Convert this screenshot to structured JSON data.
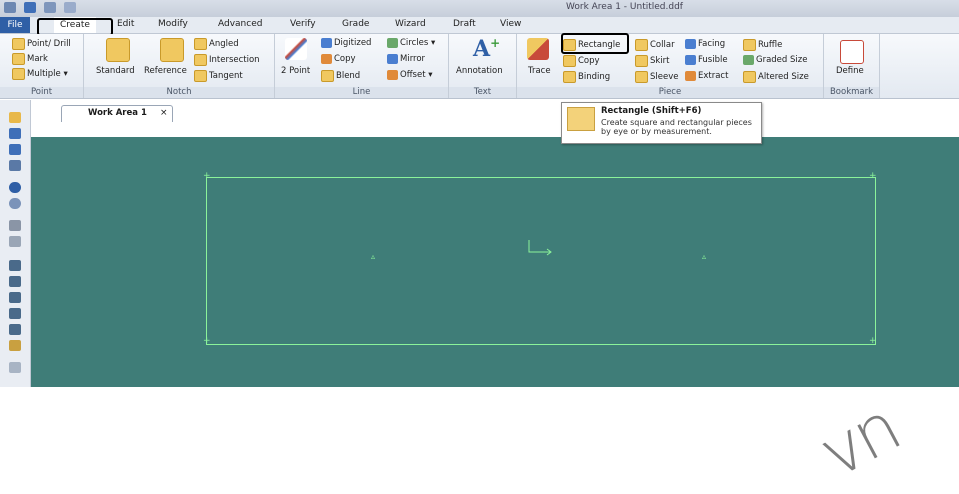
{
  "window": {
    "title": "Work Area 1 - Untitled.ddf"
  },
  "menu": {
    "file": "File",
    "create": "Create",
    "edit": "Edit",
    "modify": "Modify",
    "advanced": "Advanced",
    "verify": "Verify",
    "grade": "Grade",
    "wizard": "Wizard",
    "draft": "Draft",
    "view": "View"
  },
  "ribbon": {
    "point": {
      "label": "Point",
      "point_drill": "Point/ Drill",
      "mark": "Mark",
      "multiple": "Multiple ▾"
    },
    "notch": {
      "label": "Notch",
      "standard": "Standard",
      "reference": "Reference",
      "angled": "Angled",
      "intersection": "Intersection",
      "tangent": "Tangent"
    },
    "line": {
      "label": "Line",
      "two_point": "2 Point",
      "digitized": "Digitized",
      "copy": "Copy",
      "blend": "Blend",
      "circles": "Circles ▾",
      "mirror": "Mirror",
      "offset": "Offset ▾"
    },
    "text": {
      "label": "Text",
      "annotation": "Annotation"
    },
    "piece": {
      "label": "Piece",
      "trace": "Trace",
      "rectangle": "Rectangle",
      "copy": "Copy",
      "binding": "Binding",
      "collar": "Collar",
      "skirt": "Skirt",
      "sleeve": "Sleeve",
      "facing": "Facing",
      "fusible": "Fusible",
      "extract": "Extract",
      "ruffle": "Ruffle",
      "graded_size": "Graded Size",
      "altered_size": "Altered Size"
    },
    "bookmark": {
      "label": "Bookmark",
      "define": "Define"
    }
  },
  "tooltip": {
    "title": "Rectangle (Shift+F6)",
    "body": "Create square and rectangular pieces by eye or by measurement."
  },
  "workarea": {
    "tab_label": "Work Area 1",
    "close": "×"
  },
  "watermark": "vn"
}
